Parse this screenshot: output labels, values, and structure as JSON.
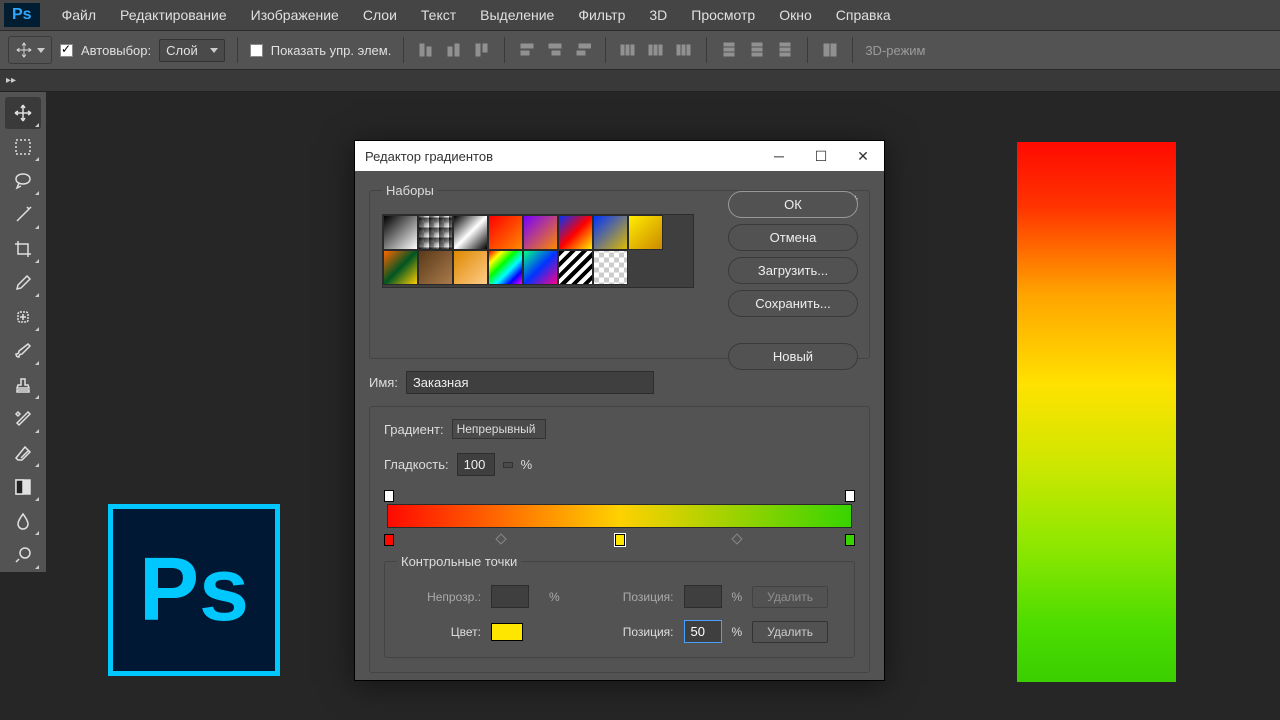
{
  "menu": {
    "items": [
      "Файл",
      "Редактирование",
      "Изображение",
      "Слои",
      "Текст",
      "Выделение",
      "Фильтр",
      "3D",
      "Просмотр",
      "Окно",
      "Справка"
    ],
    "logo": "Ps"
  },
  "options": {
    "autoselect": "Автовыбор:",
    "layer": "Слой",
    "showctrl": "Показать упр. элем.",
    "mode3d": "3D-режим"
  },
  "expand": "▸▸",
  "dialog": {
    "title": "Редактор градиентов",
    "buttons": {
      "ok": "ОК",
      "cancel": "Отмена",
      "load": "Загрузить...",
      "save": "Сохранить...",
      "new": "Новый"
    },
    "presets_label": "Наборы",
    "name_label": "Имя:",
    "name_value": "Заказная",
    "grad_label": "Градиент:",
    "grad_type": "Непрерывный",
    "smooth_label": "Гладкость:",
    "smooth_value": "100",
    "pct": "%",
    "stops_label": "Контрольные точки",
    "opacity_label": "Непрозр.:",
    "pos_label": "Позиция:",
    "color_label": "Цвет:",
    "delete": "Удалить",
    "selected_pos": "50",
    "selected_color": "#ffe600",
    "gradient": {
      "left": "#ff0a00",
      "mid": "#ffd100",
      "right": "#37d400"
    }
  },
  "tools": [
    "move",
    "marquee",
    "lasso",
    "wand",
    "crop",
    "eyedropper",
    "heal",
    "brush",
    "stamp",
    "history",
    "eraser",
    "gradient",
    "blur",
    "dodge"
  ]
}
